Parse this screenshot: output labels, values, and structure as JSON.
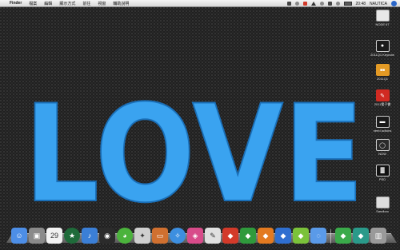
{
  "menubar": {
    "apple": "",
    "items": [
      "Finder",
      "檔案",
      "編輯",
      "顯示方式",
      "前往",
      "視窗",
      "輔助說明"
    ],
    "clock": "20:48",
    "user": "NAUTICA",
    "battery": "3:31"
  },
  "artwork": {
    "text": "LOVE",
    "color": "#3aa3f0"
  },
  "desktop_icons": [
    {
      "label": "NODE 67",
      "icon": "drive-icon",
      "color": "#e8e8e8"
    },
    {
      "label": "2011Q1 Keynote",
      "icon": "keynote-doc-icon",
      "color": "#1a1a1a"
    },
    {
      "label": "2011Q1",
      "icon": "folder-icon",
      "color": "#e39a25"
    },
    {
      "label": "2011電子書",
      "icon": "pdf-icon",
      "color": "#d12a22"
    },
    {
      "label": "need actions",
      "icon": "action-doc-icon",
      "color": "#1a1a1a"
    },
    {
      "label": "NOW",
      "icon": "mirror-doc-icon",
      "color": "#2a2a2a"
    },
    {
      "label": "PSD",
      "icon": "psd-doc-icon",
      "color": "#111111"
    },
    {
      "label": "Sandbox",
      "icon": "sandbox-icon",
      "color": "#dddddd"
    }
  ],
  "dock": [
    {
      "name": "finder-icon",
      "glyph": "☺",
      "color": "#4d8ee6"
    },
    {
      "name": "activity-monitor-icon",
      "glyph": "▣",
      "color": "#8a8a8a"
    },
    {
      "name": "ical-icon",
      "glyph": "29",
      "color": "#f2f2f2"
    },
    {
      "name": "starbucks-icon",
      "glyph": "★",
      "color": "#1f6b3a"
    },
    {
      "name": "itunes-icon",
      "glyph": "♪",
      "color": "#3b7fd6"
    },
    {
      "name": "photo-booth-icon",
      "glyph": "◉",
      "color": "#2b2b2b"
    },
    {
      "name": "adium-icon",
      "glyph": "◕",
      "color": "#4bb33c"
    },
    {
      "name": "address-book-icon",
      "glyph": "✦",
      "color": "#cfcfcf"
    },
    {
      "name": "keynote-icon",
      "glyph": "▭",
      "color": "#d07030"
    },
    {
      "name": "safari-icon",
      "glyph": "✧",
      "color": "#3d8fe0"
    },
    {
      "name": "colorsync-icon",
      "glyph": "◈",
      "color": "#d84b8a"
    },
    {
      "name": "textwrangler-icon",
      "glyph": "✎",
      "color": "#e0e0e0"
    },
    {
      "name": "app-red-icon",
      "glyph": "◆",
      "color": "#d33a2a"
    },
    {
      "name": "app-green-icon",
      "glyph": "◆",
      "color": "#2f9a3c"
    },
    {
      "name": "app-orange-icon",
      "glyph": "◆",
      "color": "#e37a20"
    },
    {
      "name": "app-blue-icon",
      "glyph": "◆",
      "color": "#2f6fd0"
    },
    {
      "name": "app-lime-icon",
      "glyph": "◆",
      "color": "#7bc23a"
    },
    {
      "name": "chat-icon",
      "glyph": "◌",
      "color": "#5a9ae8"
    },
    {
      "name": "app-green2-icon",
      "glyph": "◆",
      "color": "#3aaa4a"
    },
    {
      "name": "app-teal-icon",
      "glyph": "◆",
      "color": "#2a9a8a"
    },
    {
      "name": "trash-icon",
      "glyph": "▥",
      "color": "#9a9a9a"
    }
  ]
}
